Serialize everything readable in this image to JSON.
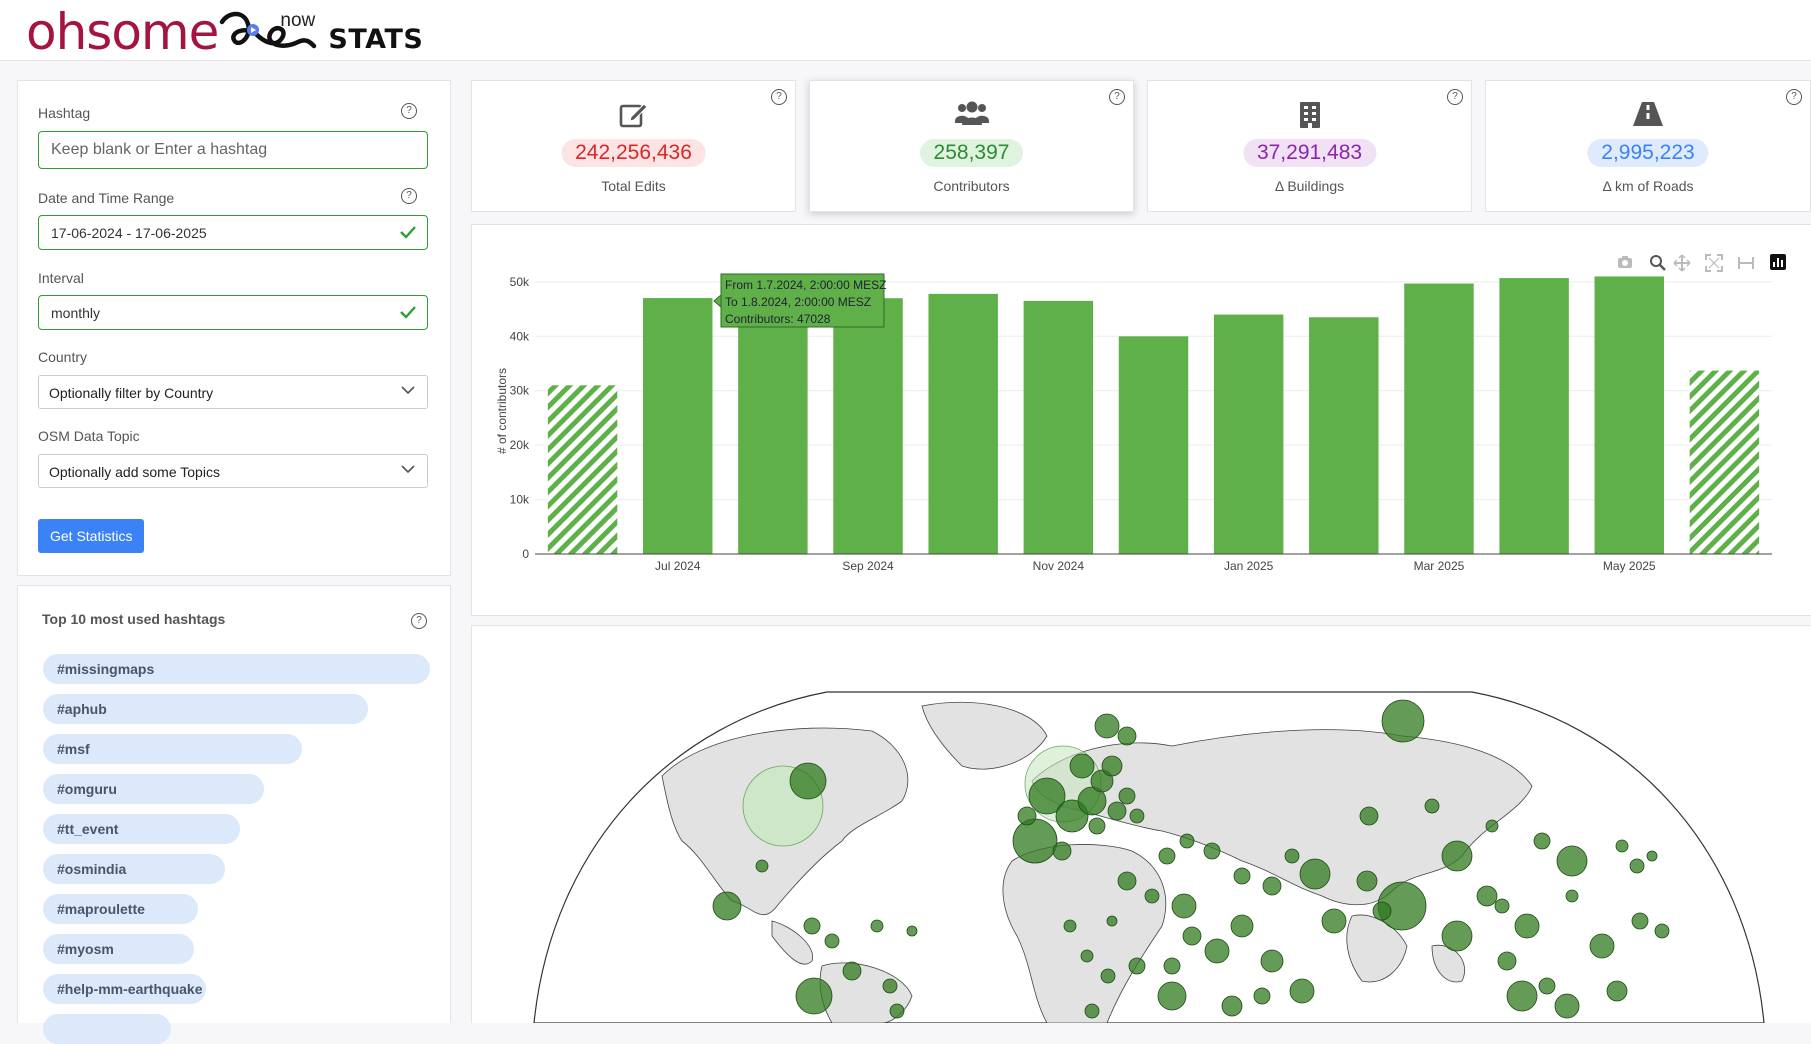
{
  "header": {
    "logo_main": "ohsome",
    "logo_now": "now",
    "logo_stats": "STATS"
  },
  "form": {
    "hashtag_label": "Hashtag",
    "hashtag_placeholder": "Keep blank or Enter a hashtag",
    "date_label": "Date and Time Range",
    "date_value": "17-06-2024 - 17-06-2025",
    "interval_label": "Interval",
    "interval_value": "monthly",
    "country_label": "Country",
    "country_value": "Optionally filter by Country",
    "topic_label": "OSM Data Topic",
    "topic_value": "Optionally add some Topics",
    "submit_label": "Get Statistics"
  },
  "stats": [
    {
      "value": "242,256,436",
      "label": "Total Edits",
      "icon": "edit-icon",
      "color": "#dc2626",
      "bg": "#fde4e4"
    },
    {
      "value": "258,397",
      "label": "Contributors",
      "icon": "users-icon",
      "color": "#2e8b35",
      "bg": "#dff3df"
    },
    {
      "value": "37,291,483",
      "label": "Δ Buildings",
      "icon": "building-icon",
      "color": "#8e24aa",
      "bg": "#f0e1f5"
    },
    {
      "value": "2,995,223",
      "label": "Δ km of Roads",
      "icon": "road-icon",
      "color": "#3b82f6",
      "bg": "#dfeafc"
    }
  ],
  "top_hashtags": {
    "title": "Top 10 most used hashtags",
    "items": [
      {
        "label": "#missingmaps",
        "share": 1.0
      },
      {
        "label": "#aphub",
        "share": 0.84
      },
      {
        "label": "#msf",
        "share": 0.67
      },
      {
        "label": "#omguru",
        "share": 0.57
      },
      {
        "label": "#tt_event",
        "share": 0.51
      },
      {
        "label": "#osmindia",
        "share": 0.47
      },
      {
        "label": "#maproulette",
        "share": 0.4
      },
      {
        "label": "#myosm",
        "share": 0.39
      },
      {
        "label": "#help-mm-earthquake",
        "share": 0.42
      },
      {
        "label": "",
        "share": 0.33
      }
    ]
  },
  "chart_data": {
    "type": "bar",
    "ylabel": "# of contributors",
    "xlabel": "",
    "ylim": [
      0,
      52000
    ],
    "yticks": [
      0,
      10000,
      20000,
      30000,
      40000,
      50000
    ],
    "ytick_labels": [
      "0",
      "10k",
      "20k",
      "30k",
      "40k",
      "50k"
    ],
    "categories": [
      "Jun 2024",
      "Jul 2024",
      "Aug 2024",
      "Sep 2024",
      "Oct 2024",
      "Nov 2024",
      "Dec 2024",
      "Jan 2025",
      "Feb 2025",
      "Mar 2025",
      "Apr 2025",
      "May 2025",
      "Jun 2025"
    ],
    "values": [
      31000,
      47028,
      47000,
      47000,
      47800,
      46500,
      40000,
      44000,
      43500,
      49700,
      50700,
      51000,
      33700
    ],
    "partial": [
      true,
      false,
      false,
      false,
      false,
      false,
      false,
      false,
      false,
      false,
      false,
      false,
      true
    ],
    "xtick_labels": [
      {
        "index": 1,
        "text": "Jul 2024"
      },
      {
        "index": 3,
        "text": "Sep 2024"
      },
      {
        "index": 5,
        "text": "Nov 2024"
      },
      {
        "index": 7,
        "text": "Jan 2025"
      },
      {
        "index": 9,
        "text": "Mar 2025"
      },
      {
        "index": 11,
        "text": "May 2025"
      }
    ],
    "bar_color": "#60b04a",
    "grid": true,
    "tooltip": {
      "line1": "From 1.7.2024, 2:00:00 MESZ",
      "line2": "To 1.8.2024, 2:00:00 MESZ",
      "line3": "Contributors: 47028"
    }
  },
  "toolbar": [
    "camera-icon",
    "zoom-icon",
    "pan-icon",
    "autoscale-icon",
    "reset-axes-icon",
    "plotly-logo-icon"
  ],
  "map": {
    "bubble_color": "#2f7a1f"
  }
}
